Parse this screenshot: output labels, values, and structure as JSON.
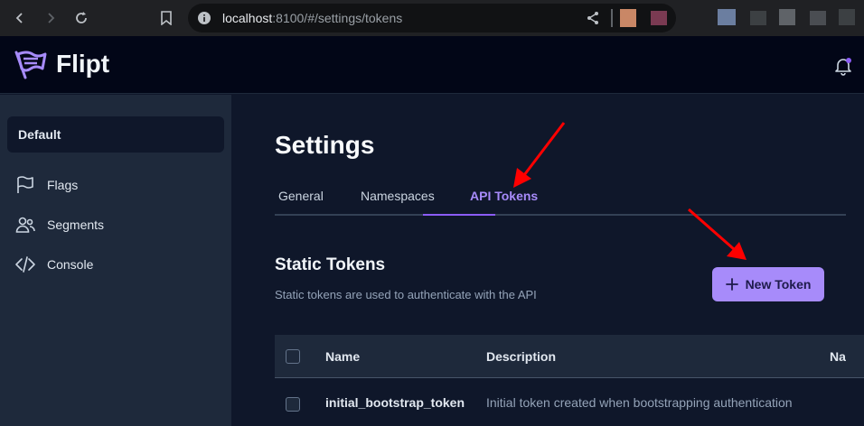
{
  "browser": {
    "url_host": "localhost",
    "url_rest": ":8100/#/settings/tokens"
  },
  "app": {
    "brand": "Flipt"
  },
  "sidebar": {
    "namespace": "Default",
    "items": [
      {
        "label": "Flags",
        "icon": "flag-icon"
      },
      {
        "label": "Segments",
        "icon": "users-icon"
      },
      {
        "label": "Console",
        "icon": "code-icon"
      }
    ]
  },
  "main": {
    "title": "Settings",
    "tabs": [
      {
        "label": "General"
      },
      {
        "label": "Namespaces"
      },
      {
        "label": "API Tokens"
      }
    ],
    "active_tab": "API Tokens",
    "section": {
      "title": "Static Tokens",
      "subtitle": "Static tokens are used to authenticate with the API",
      "new_button": "New Token"
    },
    "table": {
      "headers": [
        "Name",
        "Description",
        "Na"
      ],
      "rows": [
        {
          "name": "initial_bootstrap_token",
          "description": "Initial token created when bootstrapping authentication"
        }
      ]
    }
  },
  "colors": {
    "accent": "#a78bfa",
    "annotation_arrow": "#ff0000"
  }
}
